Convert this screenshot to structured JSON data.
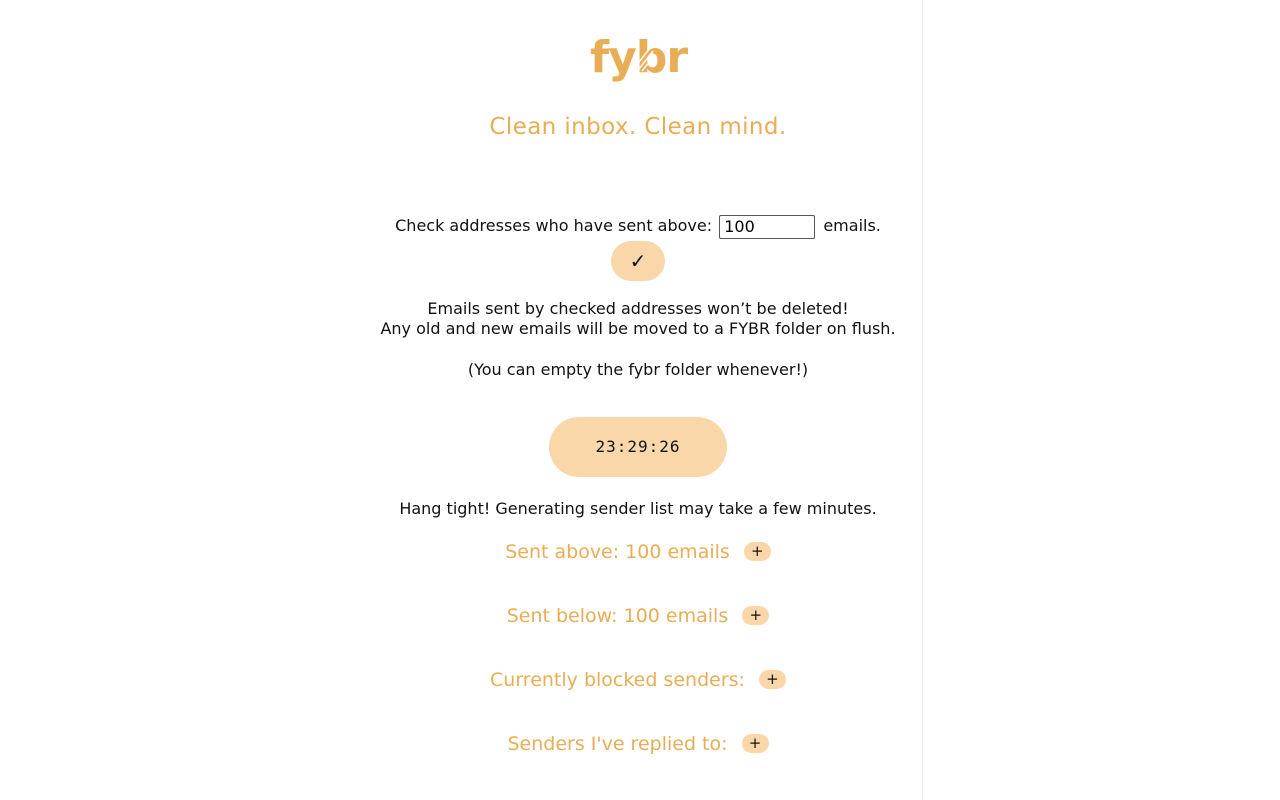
{
  "brand": {
    "logo_text": "fybr",
    "tagline": "Clean inbox. Clean mind.",
    "accent_color": "#e9ad55",
    "button_color": "#fad7a8"
  },
  "threshold": {
    "label_before": "Check addresses who have sent above:",
    "value": "100",
    "label_after": "emails.",
    "confirm_symbol": "✓"
  },
  "info": {
    "line1": "Emails sent by checked addresses won’t be deleted!",
    "line2": "Any old and new emails will be moved to a FYBR folder on flush.",
    "line3": "(You can empty the fybr folder whenever!)"
  },
  "timer": {
    "value": "23:29:26"
  },
  "status": {
    "message": "Hang tight! Generating sender list may take a few minutes."
  },
  "sections": [
    {
      "label": "Sent above: 100 emails",
      "button": "+"
    },
    {
      "label": "Sent below: 100 emails",
      "button": "+"
    },
    {
      "label": "Currently blocked senders:",
      "button": "+"
    },
    {
      "label": "Senders I've replied to:",
      "button": "+"
    }
  ]
}
